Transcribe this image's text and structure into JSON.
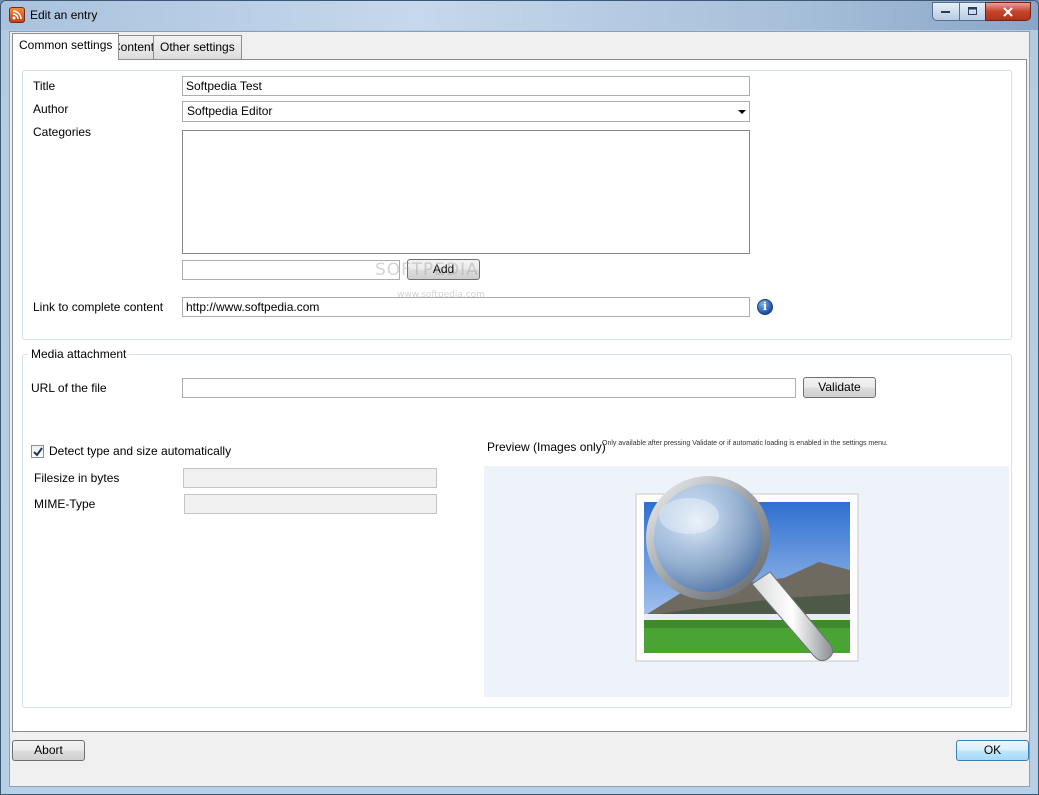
{
  "window": {
    "title": "Edit an entry"
  },
  "tabs": [
    {
      "label": "Common settings",
      "active": true
    },
    {
      "label": "Content",
      "active": false
    },
    {
      "label": "Other settings",
      "active": false
    }
  ],
  "common": {
    "title_label": "Title",
    "title_value": "Softpedia Test",
    "author_label": "Author",
    "author_value": "Softpedia Editor",
    "categories_label": "Categories",
    "category_input_value": "",
    "add_button": "Add",
    "link_label": "Link to complete content",
    "link_value": "http://www.softpedia.com"
  },
  "media": {
    "legend": "Media attachment",
    "url_label": "URL of the file",
    "url_value": "",
    "validate_button": "Validate",
    "detect_label": "Detect type and size automatically",
    "detect_checked": true,
    "filesize_label": "Filesize in bytes",
    "filesize_value": "",
    "mime_label": "MIME-Type",
    "mime_value": "",
    "preview_label": "Preview (Images only)",
    "preview_hint": "Only available after pressing Validate or if automatic loading is enabled in the settings menu."
  },
  "footer": {
    "abort_button": "Abort",
    "ok_button": "OK"
  },
  "watermark": {
    "brand": "SOFTPEDIA",
    "url": "www.softpedia.com"
  },
  "icons": {
    "app": "app-feed-icon",
    "info": "info-icon",
    "preview": "magnifier-photo-icon"
  },
  "colors": {
    "accent": "#3c7fb1",
    "close": "#c6432b"
  }
}
